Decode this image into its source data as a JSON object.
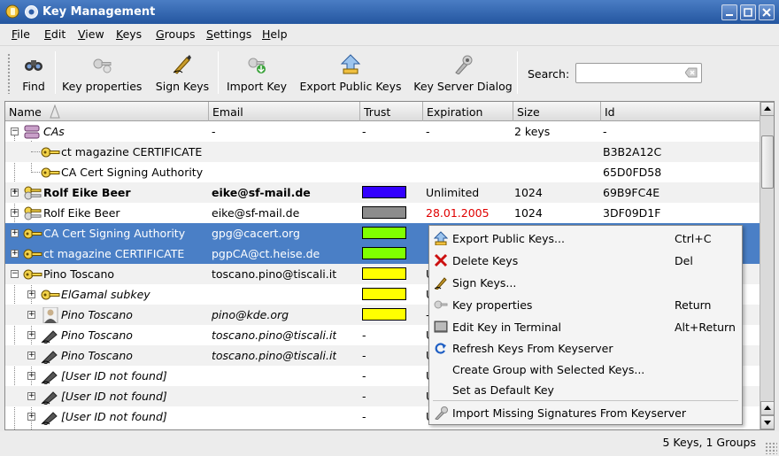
{
  "window": {
    "title": "Key Management"
  },
  "menubar": [
    {
      "label": "File",
      "mnemonic": "F",
      "rest": "ile"
    },
    {
      "label": "Edit",
      "mnemonic": "E",
      "rest": "dit"
    },
    {
      "label": "View",
      "mnemonic": "V",
      "rest": "iew"
    },
    {
      "label": "Keys",
      "mnemonic": "K",
      "rest": "eys"
    },
    {
      "label": "Groups",
      "mnemonic": "G",
      "rest": "roups"
    },
    {
      "label": "Settings",
      "mnemonic": "S",
      "rest": "ettings"
    },
    {
      "label": "Help",
      "mnemonic": "H",
      "rest": "elp"
    }
  ],
  "toolbar": {
    "find": "Find",
    "key_properties": "Key properties",
    "sign_keys": "Sign Keys",
    "import_key": "Import Key",
    "export_public_keys": "Export Public Keys",
    "key_server_dialog": "Key Server Dialog",
    "search_label": "Search:",
    "search_value": ""
  },
  "columns": [
    "Name",
    "Email",
    "Trust",
    "Expiration",
    "Size",
    "Id"
  ],
  "rows": [
    {
      "name": "CAs",
      "email": "-",
      "trust": "-",
      "expiration": "-",
      "size": "2 keys",
      "id": "-"
    },
    {
      "name": "ct magazine CERTIFICATE",
      "email": "",
      "trust": "",
      "expiration": "",
      "size": "",
      "id": "B3B2A12C"
    },
    {
      "name": "CA Cert Signing Authority",
      "email": "",
      "trust": "",
      "expiration": "",
      "size": "",
      "id": "65D0FD58"
    },
    {
      "name": "Rolf Eike Beer",
      "email": "eike@sf-mail.de",
      "trust": "",
      "expiration": "Unlimited",
      "size": "1024",
      "id": "69B9FC4E"
    },
    {
      "name": "Rolf Eike Beer",
      "email": "eike@sf-mail.de",
      "trust": "",
      "expiration": "28.01.2005",
      "size": "1024",
      "id": "3DF09D1F"
    },
    {
      "name": "CA Cert Signing Authority",
      "email": "gpg@cacert.org",
      "trust": "",
      "expiration": "",
      "size": "",
      "id": ""
    },
    {
      "name": "ct magazine CERTIFICATE",
      "email": "pgpCA@ct.heise.de",
      "trust": "",
      "expiration": "",
      "size": "",
      "id": ""
    },
    {
      "name": "Pino Toscano",
      "email": "toscano.pino@tiscali.it",
      "trust": "",
      "expiration": "U",
      "size": "",
      "id": ""
    },
    {
      "name": "ElGamal subkey",
      "email": "",
      "trust": "",
      "expiration": "U",
      "size": "",
      "id": ""
    },
    {
      "name": "Pino Toscano",
      "email": "pino@kde.org",
      "trust": "",
      "expiration": "-",
      "size": "",
      "id": ""
    },
    {
      "name": "Pino Toscano",
      "email": "toscano.pino@tiscali.it",
      "trust": "-",
      "expiration": "U",
      "size": "",
      "id": ""
    },
    {
      "name": "Pino Toscano",
      "email": "toscano.pino@tiscali.it",
      "trust": "-",
      "expiration": "U",
      "size": "",
      "id": ""
    },
    {
      "name": "[User ID not found]",
      "email": "",
      "trust": "-",
      "expiration": "U",
      "size": "",
      "id": ""
    },
    {
      "name": "[User ID not found]",
      "email": "",
      "trust": "-",
      "expiration": "U",
      "size": "",
      "id": ""
    },
    {
      "name": "[User ID not found]",
      "email": "",
      "trust": "-",
      "expiration": "U",
      "size": "",
      "id": ""
    }
  ],
  "context_menu": [
    {
      "label": "Export Public Keys...",
      "shortcut": "Ctrl+C",
      "mnemonic": "x",
      "icon": "export-icon"
    },
    {
      "label": "Delete Keys",
      "shortcut": "Del",
      "mnemonic": "D",
      "icon": "delete-icon"
    },
    {
      "label": "Sign Keys...",
      "shortcut": "",
      "mnemonic": "S",
      "icon": "sign-icon"
    },
    {
      "label": "Key properties",
      "shortcut": "Return",
      "mnemonic": "K",
      "icon": "key-properties-icon"
    },
    {
      "label": "Edit Key in Terminal",
      "shortcut": "Alt+Return",
      "mnemonic": "T",
      "icon": "terminal-icon"
    },
    {
      "label": "Refresh Keys From Keyserver",
      "shortcut": "",
      "mnemonic": "R",
      "icon": "refresh-icon"
    },
    {
      "label": "Create Group with Selected Keys...",
      "shortcut": "",
      "mnemonic": "C",
      "icon": ""
    },
    {
      "label": "Set as Default Key",
      "shortcut": "",
      "mnemonic": "",
      "icon": ""
    },
    {
      "label": "Import Missing Signatures From Keyserver",
      "shortcut": "",
      "mnemonic": "M",
      "icon": "import-signatures-icon"
    }
  ],
  "status": "5 Keys, 1 Groups",
  "colors": {
    "selection": "#4a7fc6",
    "trust_ultimate": "#3300ff",
    "trust_disabled": "#8c8c8c",
    "trust_full": "#80ff00",
    "trust_marginal": "#ffff00",
    "expired_text": "#e00000"
  }
}
